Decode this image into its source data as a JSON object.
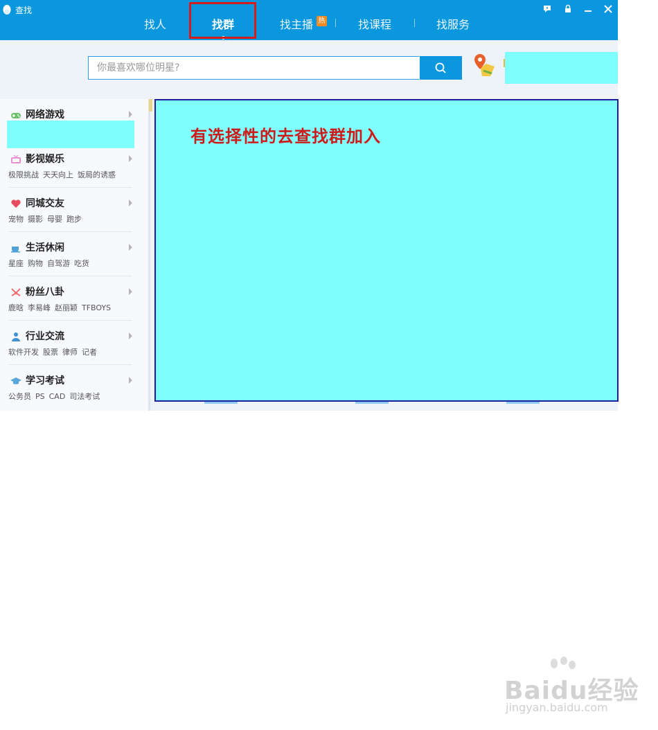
{
  "window": {
    "title": "查找"
  },
  "nav": {
    "tabs": [
      {
        "label": "找人"
      },
      {
        "label": "找群"
      },
      {
        "label": "找主播",
        "badge": "热"
      },
      {
        "label": "找课程"
      },
      {
        "label": "找服务"
      }
    ],
    "active": "找群"
  },
  "search": {
    "placeholder": "你最喜欢哪位明星?",
    "value": ""
  },
  "sidebar": {
    "categories": [
      {
        "title": "网络游戏",
        "icon": "gamepad-icon",
        "tags": []
      },
      {
        "title": "影视娱乐",
        "icon": "tv-icon",
        "tags": [
          "极限挑战",
          "天天向上",
          "饭局的诱惑"
        ]
      },
      {
        "title": "同城交友",
        "icon": "heart-icon",
        "tags": [
          "宠物",
          "摄影",
          "母婴",
          "跑步"
        ]
      },
      {
        "title": "生活休闲",
        "icon": "coffee-cup-icon",
        "tags": [
          "星座",
          "购物",
          "自驾游",
          "吃货"
        ]
      },
      {
        "title": "粉丝八卦",
        "icon": "fan-icon",
        "tags": [
          "鹿晗",
          "李易峰",
          "赵丽颖",
          "TFBOYS"
        ]
      },
      {
        "title": "行业交流",
        "icon": "person-icon",
        "tags": [
          "软件开发",
          "股票",
          "律师",
          "记者"
        ]
      },
      {
        "title": "学习考试",
        "icon": "graduation-cap-icon",
        "tags": [
          "公务员",
          "PS",
          "CAD",
          "司法考试"
        ]
      }
    ]
  },
  "annotation": {
    "text": "有选择性的去查找群加入"
  },
  "watermark": {
    "brand": "Baidu经验",
    "url": "jingyan.baidu.com"
  },
  "colors": {
    "titlebar": "#0b97de",
    "highlight": "#d51c1c",
    "cover": "#80ffff",
    "annotation": "#cc1b1b"
  }
}
